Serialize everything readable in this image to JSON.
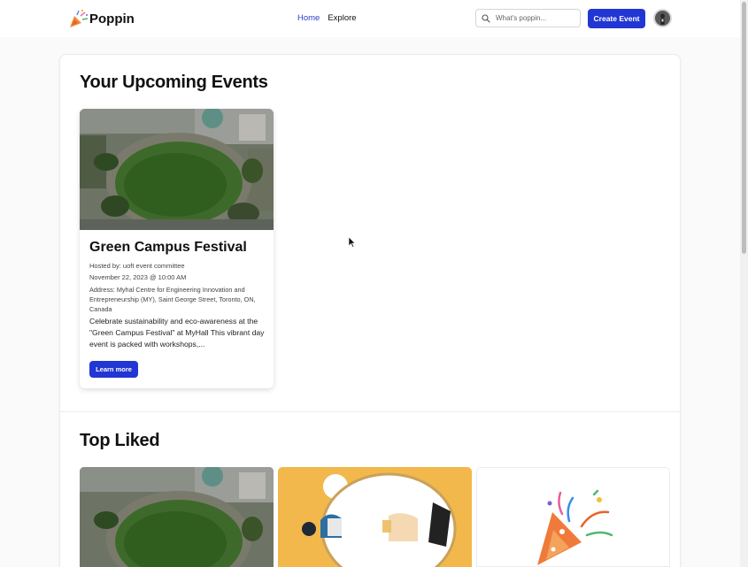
{
  "app": {
    "name": "Poppin"
  },
  "nav": {
    "home": "Home",
    "explore": "Explore"
  },
  "search": {
    "placeholder": "What's poppin..."
  },
  "header": {
    "create_event": "Create Event"
  },
  "upcoming": {
    "title": "Your Upcoming Events",
    "events": [
      {
        "title": "Green Campus Festival",
        "host": "Hosted by: uoft event committee",
        "date": "November 22, 2023 @ 10:00 AM",
        "address": "Address: Myhal Centre for Engineering Innovation and Entrepreneurship (MY), Saint George Street, Toronto, ON, Canada",
        "description": "Celebrate sustainability and eco-awareness at the \"Green Campus Festival\" at MyHall This vibrant day event is packed with workshops,...",
        "cta": "Learn more"
      }
    ]
  },
  "top_liked": {
    "title": "Top Liked"
  },
  "colors": {
    "accent": "#2236d4",
    "nav_active": "#2b3fc8",
    "illustration_yellow": "#f2b84b"
  },
  "icons": [
    "party-popper-logo-icon",
    "search-icon",
    "user-avatar",
    "mouse-cursor-icon"
  ]
}
